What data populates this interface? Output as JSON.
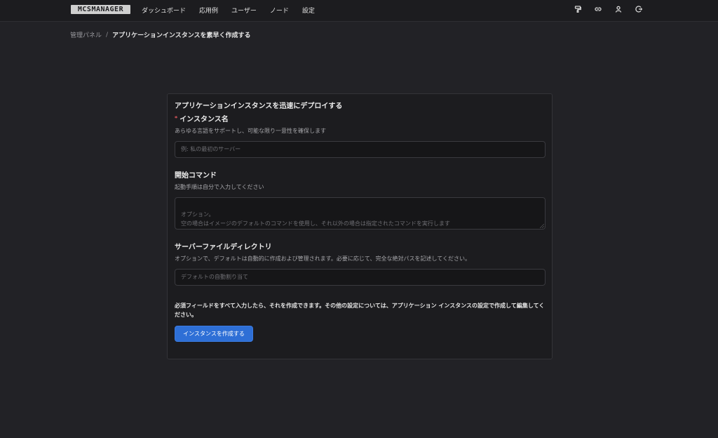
{
  "header": {
    "logo": "MCSMANAGER",
    "nav": [
      {
        "label": "ダッシュボード"
      },
      {
        "label": "応用例"
      },
      {
        "label": "ユーザー"
      },
      {
        "label": "ノード"
      },
      {
        "label": "設定"
      }
    ],
    "icons": [
      "paint-roller-icon",
      "link-icon",
      "user-icon",
      "logout-icon"
    ]
  },
  "breadcrumb": {
    "parent": "管理パネル",
    "separator": "/",
    "current": "アプリケーションインスタンスを素早く作成する"
  },
  "form": {
    "title": "アプリケーションインスタンスを迅速にデプロイする",
    "instance_name": {
      "required_mark": "*",
      "label": "インスタンス名",
      "help": "あらゆる言語をサポートし、可能な限り一意性を確保します",
      "placeholder": "例: 私の最初のサーバー",
      "value": ""
    },
    "start_command": {
      "label": "開始コマンド",
      "help": "起動手順は自分で入力してください",
      "placeholder": "オプション。\n空の場合はイメージのデフォルトのコマンドを使用し、それ以外の場合は指定されたコマンドを実行します",
      "value": ""
    },
    "server_directory": {
      "label": "サーバーファイルディレクトリ",
      "help": "オプションで、デフォルトは自動的に作成および管理されます。必要に応じて、完全な絶対パスを記述してください。",
      "placeholder": "デフォルトの自動割り当て",
      "value": ""
    },
    "note": "必須フィールドをすべて入力したら、それを作成できます。その他の設定については、アプリケーション インスタンスの設定で作成して編集してください。",
    "submit_label": "インスタンスを作成する"
  },
  "colors": {
    "background": "#222226",
    "card": "#1c1c1f",
    "accent": "#2e6fd6",
    "required": "#e0585e"
  }
}
